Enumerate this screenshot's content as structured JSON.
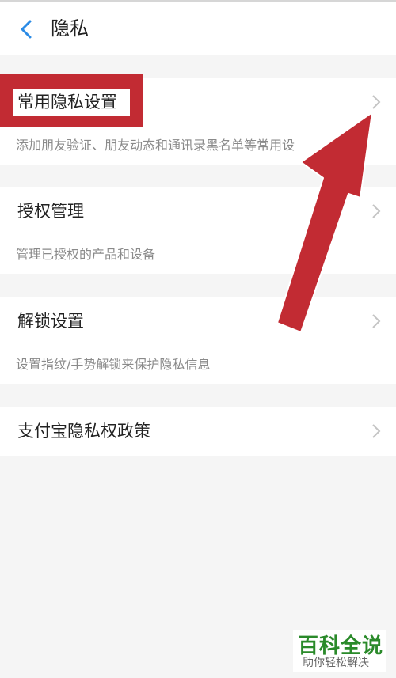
{
  "header": {
    "title": "隐私"
  },
  "rows": [
    {
      "label": "常用隐私设置",
      "subtitle": "添加朋友验证、朋友动态和通讯录黑名单等常用设"
    },
    {
      "label": "授权管理",
      "subtitle": "管理已授权的产品和设备"
    },
    {
      "label": "解锁设置",
      "subtitle": "设置指纹/手势解锁来保护隐私信息"
    },
    {
      "label": "支付宝隐私权政策"
    }
  ],
  "watermark": {
    "brand": "百科全说",
    "tagline": "助你轻松解决"
  },
  "colors": {
    "accent": "#2b8be6",
    "annotation_red": "#c22b33",
    "watermark_green": "#2a8a2a"
  }
}
